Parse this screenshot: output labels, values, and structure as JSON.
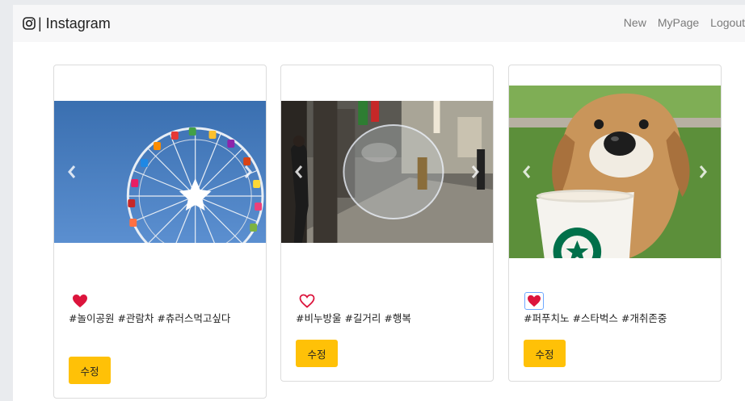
{
  "navbar": {
    "brand": "| Instagram",
    "links": [
      "New",
      "MyPage",
      "Logout"
    ]
  },
  "posts": [
    {
      "tags": "#놀이공원 #관람차 #츄러스먹고싶다",
      "liked": true,
      "edit_label": "수정"
    },
    {
      "tags": "#비누방울 #길거리 #행복",
      "liked": false,
      "edit_label": "수정"
    },
    {
      "tags": "#퍼푸치노 #스타벅스 #개취존중",
      "liked": true,
      "edit_label": "수정"
    }
  ],
  "colors": {
    "heart": "#dc143c",
    "button": "#ffc107",
    "navbar_bg": "#f7f7f8"
  },
  "icons": {
    "brand": "instagram-icon",
    "prev": "chevron-left-icon",
    "next": "chevron-right-icon",
    "like": "heart-icon"
  }
}
